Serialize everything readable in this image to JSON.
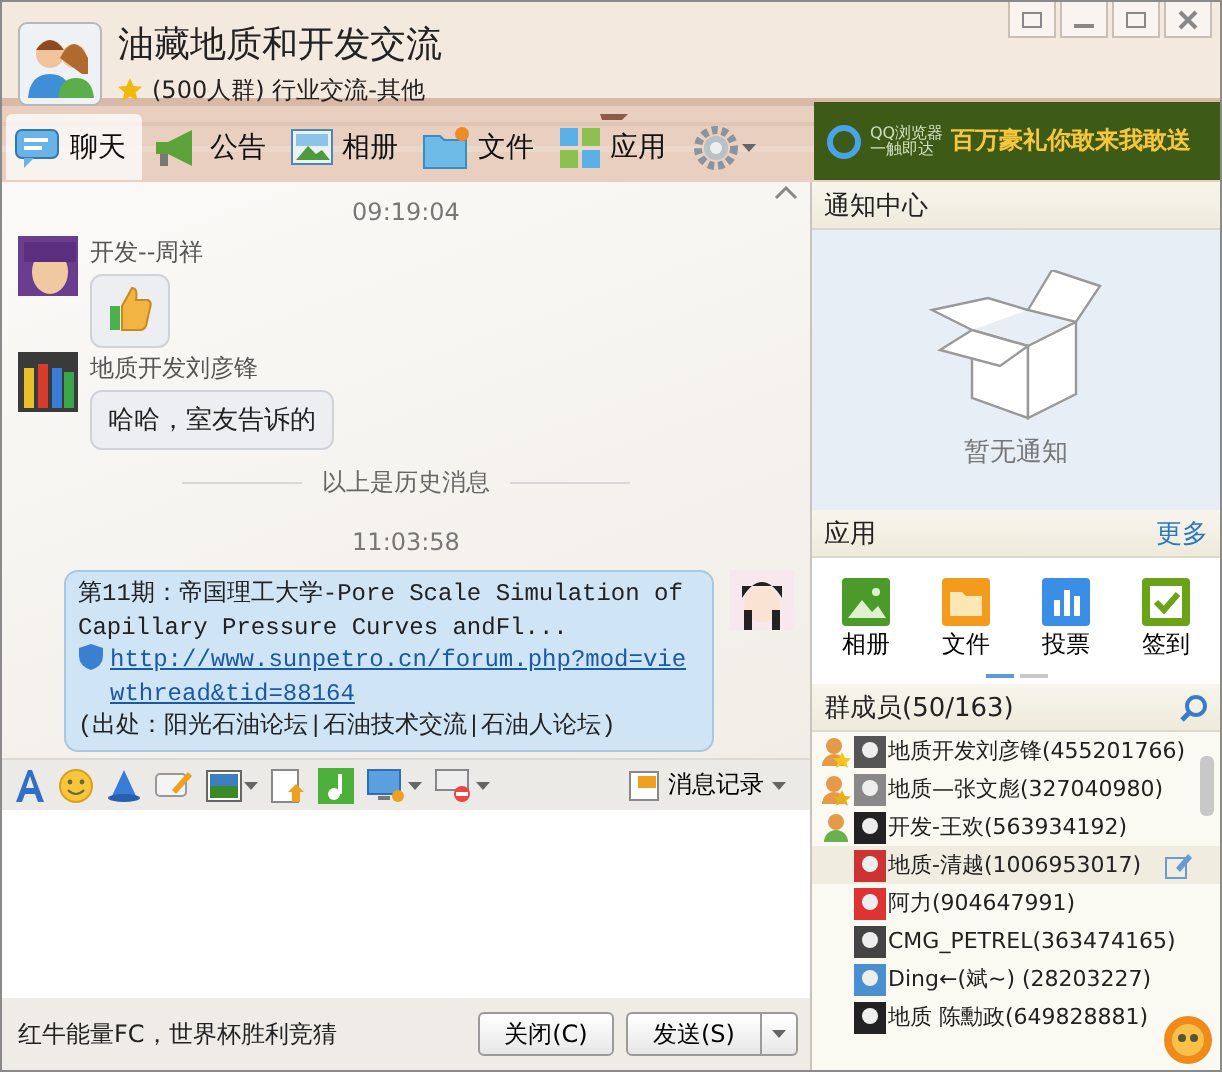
{
  "window": {
    "title": "油藏地质和开发交流",
    "subtitle": "(500人群) 行业交流-其他"
  },
  "tabs": [
    {
      "label": "聊天",
      "selected": true
    },
    {
      "label": "公告",
      "selected": false
    },
    {
      "label": "相册",
      "selected": false
    },
    {
      "label": "文件",
      "selected": false
    },
    {
      "label": "应用",
      "selected": false
    }
  ],
  "ad": {
    "logo_title": "QQ浏览器",
    "logo_sub": "一触即达",
    "text": "百万豪礼你敢来我敢送"
  },
  "messages": [
    {
      "kind": "time",
      "text": "09:19:04"
    },
    {
      "kind": "sticker",
      "sender": "开发--周祥"
    },
    {
      "kind": "incoming",
      "sender": "地质开发刘彦锋",
      "text": "哈哈，室友告诉的"
    },
    {
      "kind": "divider",
      "text": "以上是历史消息"
    },
    {
      "kind": "time",
      "text": "11:03:58"
    },
    {
      "kind": "outgoing",
      "text": "第11期：帝国理工大学-Pore Scale Simulation of Capillary Pressure Curves andFl...",
      "link": "http://www.sunpetro.cn/forum.php?mod=viewthread&tid=88164",
      "source": "(出处：阳光石油论坛|石油技术交流|石油人论坛)"
    }
  ],
  "toolbar": {
    "history_label": "消息记录"
  },
  "footer": {
    "ad_text": "红牛能量FC，世界杯胜利竞猜",
    "close_label": "关闭(C)",
    "send_label": "发送(S)"
  },
  "notifications": {
    "title": "通知中心",
    "empty_text": "暂无通知"
  },
  "apps": {
    "title": "应用",
    "more": "更多",
    "items": [
      {
        "label": "相册"
      },
      {
        "label": "文件"
      },
      {
        "label": "投票"
      },
      {
        "label": "签到"
      }
    ],
    "pages": [
      {
        "selected": true
      },
      {
        "selected": false
      }
    ]
  },
  "members": {
    "title": "群成员(50/163)",
    "items": [
      {
        "name": "地质开发刘彦锋(455201766)",
        "kind": "owner",
        "selected": false
      },
      {
        "name": "地质—张文彪(327040980)",
        "kind": "admin",
        "selected": false
      },
      {
        "name": "开发-王欢(563934192)",
        "kind": "friend",
        "selected": false
      },
      {
        "name": "地质-清越(1006953017)",
        "kind": "plain",
        "selected": true
      },
      {
        "name": "阿力(904647991)",
        "kind": "plain",
        "selected": false
      },
      {
        "name": "CMG_PETREL(363474165)",
        "kind": "plain",
        "selected": false
      },
      {
        "name": "Ding←(斌~) (28203227)",
        "kind": "plain",
        "selected": false
      },
      {
        "name": "地质 陈勳政(649828881)",
        "kind": "plain",
        "selected": false
      }
    ]
  }
}
